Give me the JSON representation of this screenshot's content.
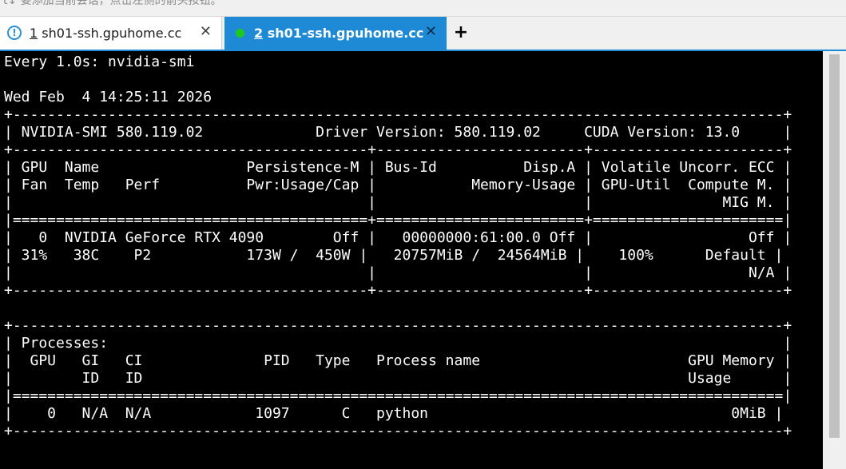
{
  "top_hint": "t↓ 要添加当前会话，点击左侧的箭头按钮。",
  "tabs": [
    {
      "number": "1",
      "title": "sh01-ssh.gpuhome.cc",
      "status": "warning",
      "close": "✕"
    },
    {
      "number": "2",
      "title": "sh01-ssh.gpuhome.cc",
      "status": "connected",
      "close": "✕"
    }
  ],
  "new_tab_label": "+",
  "colors": {
    "active_tab": "#1e8ad6",
    "connected_dot": "#1ec91e",
    "terminal_bg": "#000000",
    "terminal_fg": "#ffffff"
  },
  "terminal": {
    "lines": [
      "Every 1.0s: nvidia-smi",
      "",
      "Wed Feb  4 14:25:11 2026",
      "+-----------------------------------------------------------------------------------------+",
      "| NVIDIA-SMI 580.119.02             Driver Version: 580.119.02     CUDA Version: 13.0     |",
      "+-----------------------------------------+------------------------+----------------------+",
      "| GPU  Name                 Persistence-M | Bus-Id          Disp.A | Volatile Uncorr. ECC |",
      "| Fan  Temp   Perf          Pwr:Usage/Cap |           Memory-Usage | GPU-Util  Compute M. |",
      "|                                         |                        |               MIG M. |",
      "|=========================================+========================+======================|",
      "|   0  NVIDIA GeForce RTX 4090        Off |   00000000:61:00.0 Off |                  Off |",
      "| 31%   38C    P2           173W /  450W |   20757MiB /  24564MiB |    100%      Default |",
      "|                                         |                        |                  N/A |",
      "+-----------------------------------------+------------------------+----------------------+",
      "",
      "+-----------------------------------------------------------------------------------------+",
      "| Processes:                                                                              |",
      "|  GPU   GI   CI              PID   Type   Process name                        GPU Memory |",
      "|        ID   ID                                                               Usage      |",
      "|=========================================================================================|",
      "|    0   N/A  N/A            1097      C   python                                   0MiB |",
      "+-----------------------------------------------------------------------------------------+"
    ]
  }
}
